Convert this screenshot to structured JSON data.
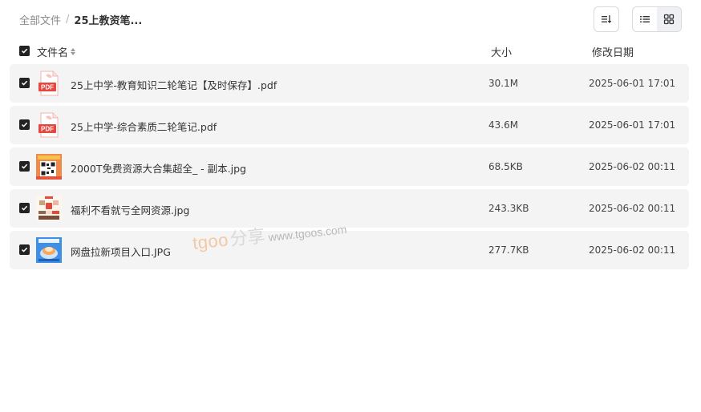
{
  "breadcrumb": {
    "root": "全部文件",
    "separator": "/",
    "current": "25上教资笔..."
  },
  "toolbar": {
    "sort_icon": "sort-icon",
    "list_icon": "list-view-icon",
    "grid_icon": "grid-view-icon"
  },
  "table": {
    "headers": {
      "name": "文件名",
      "size": "大小",
      "date": "修改日期"
    }
  },
  "files": [
    {
      "name": "25上中学-教育知识二轮笔记【及时保存】.pdf",
      "size": "30.1M",
      "date": "2025-06-01 17:01",
      "type": "pdf",
      "thumb_label": "PDF"
    },
    {
      "name": "25上中学-综合素质二轮笔记.pdf",
      "size": "43.6M",
      "date": "2025-06-01 17:01",
      "type": "pdf",
      "thumb_label": "PDF"
    },
    {
      "name": "2000T免费资源大合集超全_ - 副本.jpg",
      "size": "68.5KB",
      "date": "2025-06-02 00:11",
      "type": "image-qr"
    },
    {
      "name": "福利不看就亏全网资源.jpg",
      "size": "243.3KB",
      "date": "2025-06-02 00:11",
      "type": "image-poster"
    },
    {
      "name": "网盘拉新项目入口.JPG",
      "size": "277.7KB",
      "date": "2025-06-02 00:11",
      "type": "image-blue"
    }
  ],
  "watermark": {
    "brand": "tgoo",
    "cn": "分享",
    "url": "www.tgoos.com"
  },
  "colors": {
    "row_bg": "#f4f4f5",
    "pdf_red": "#e5463d",
    "checkbox": "#222222"
  }
}
